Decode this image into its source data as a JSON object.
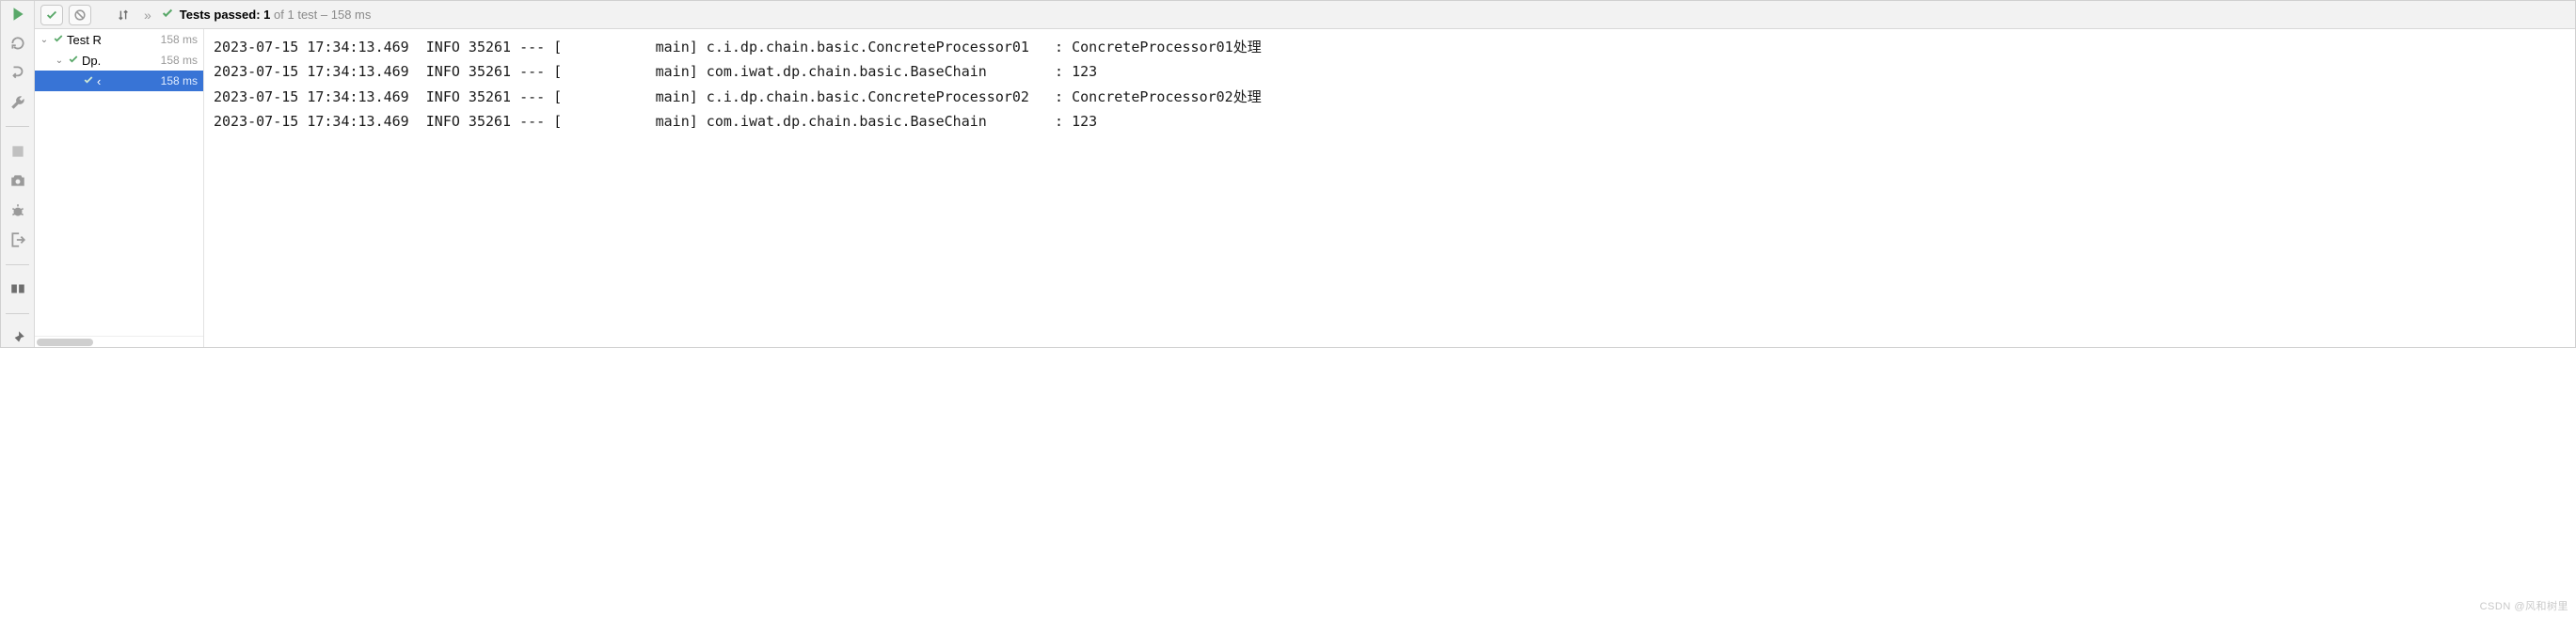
{
  "toolbar": {
    "status_prefix": "Tests passed:",
    "status_count": "1",
    "status_suffix": "of 1 test – 158 ms"
  },
  "tree": {
    "items": [
      {
        "indent": 0,
        "arrow": "⌄",
        "label": "Test R",
        "time": "158 ms",
        "selected": false
      },
      {
        "indent": 1,
        "arrow": "⌄",
        "label": "Dp.",
        "time": "158 ms",
        "selected": false
      },
      {
        "indent": 2,
        "arrow": "",
        "label": "‹",
        "time": "158 ms",
        "selected": true
      }
    ]
  },
  "console": {
    "lines": [
      "2023-07-15 17:34:13.469  INFO 35261 --- [           main] c.i.dp.chain.basic.ConcreteProcessor01   : ConcreteProcessor01处理",
      "2023-07-15 17:34:13.469  INFO 35261 --- [           main] com.iwat.dp.chain.basic.BaseChain        : 123",
      "2023-07-15 17:34:13.469  INFO 35261 --- [           main] c.i.dp.chain.basic.ConcreteProcessor02   : ConcreteProcessor02处理",
      "2023-07-15 17:34:13.469  INFO 35261 --- [           main] com.iwat.dp.chain.basic.BaseChain        : 123"
    ]
  },
  "watermark": "CSDN @风和树里"
}
